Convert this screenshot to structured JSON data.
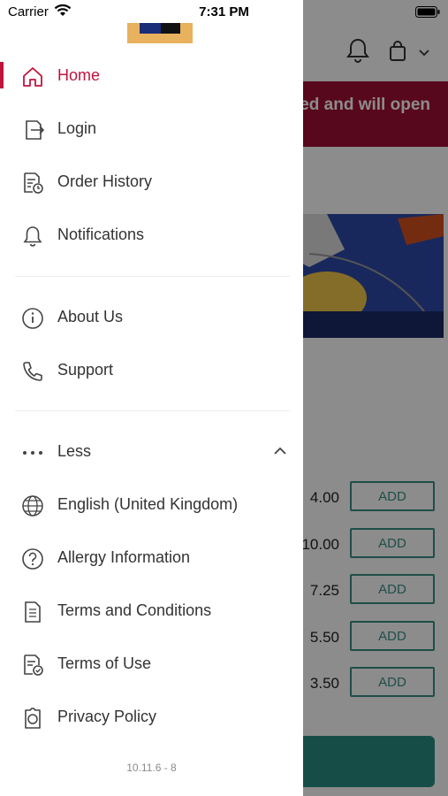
{
  "status_bar": {
    "carrier": "Carrier",
    "time": "7:31 PM"
  },
  "background": {
    "banner_text": "ed and will open",
    "prices": [
      "4.00",
      "10.00",
      "7.25",
      "5.50",
      "3.50"
    ],
    "add_label": "ADD"
  },
  "drawer": {
    "primary_items": [
      {
        "label": "Home",
        "icon": "home-icon",
        "active": true
      },
      {
        "label": "Login",
        "icon": "login-icon"
      },
      {
        "label": "Order History",
        "icon": "order-history-icon"
      },
      {
        "label": "Notifications",
        "icon": "bell-icon"
      }
    ],
    "secondary_items": [
      {
        "label": "About Us",
        "icon": "info-icon"
      },
      {
        "label": "Support",
        "icon": "phone-icon"
      }
    ],
    "more_toggle": {
      "label": "Less",
      "icon": "ellipsis-icon",
      "expanded": true
    },
    "extra_items": [
      {
        "label": "English (United Kingdom)",
        "icon": "globe-icon"
      },
      {
        "label": "Allergy Information",
        "icon": "question-icon"
      },
      {
        "label": "Terms and Conditions",
        "icon": "document-icon"
      },
      {
        "label": "Terms of Use",
        "icon": "document-check-icon"
      },
      {
        "label": "Privacy Policy",
        "icon": "privacy-icon"
      }
    ],
    "version": "10.11.6 - 8"
  },
  "colors": {
    "accent": "#c0143c",
    "banner": "#a10f34",
    "teal": "#3a8f83"
  }
}
